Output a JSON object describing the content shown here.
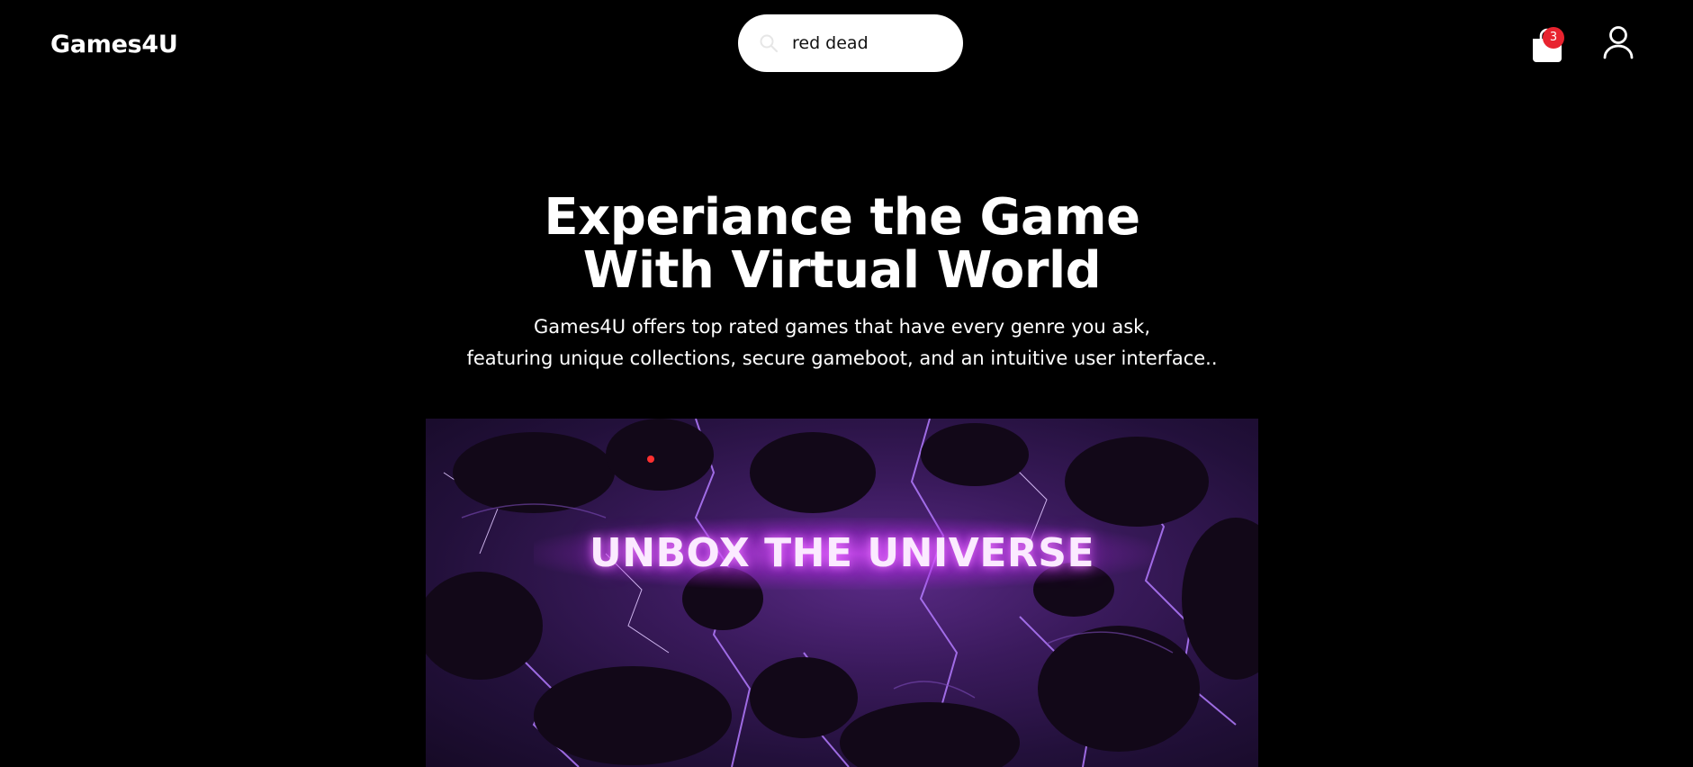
{
  "header": {
    "brand": "Games4U",
    "search": {
      "value": "red dead",
      "icon": "search-icon"
    },
    "cart": {
      "icon": "shopping-bag-icon",
      "count": "3"
    },
    "user": {
      "icon": "user-icon"
    }
  },
  "hero": {
    "title_line1": "Experiance the Game",
    "title_line2": "With Virtual World",
    "subtitle_line1": "Games4U offers top rated games that have every genre you ask,",
    "subtitle_line2": "featuring unique collections, secure gameboot, and an intuitive user interface.."
  },
  "banner": {
    "text": "UNBOX THE UNIVERSE"
  },
  "colors": {
    "background": "#000000",
    "text": "#ffffff",
    "badge": "#e8232f",
    "banner_purple": "#5a2a86"
  }
}
